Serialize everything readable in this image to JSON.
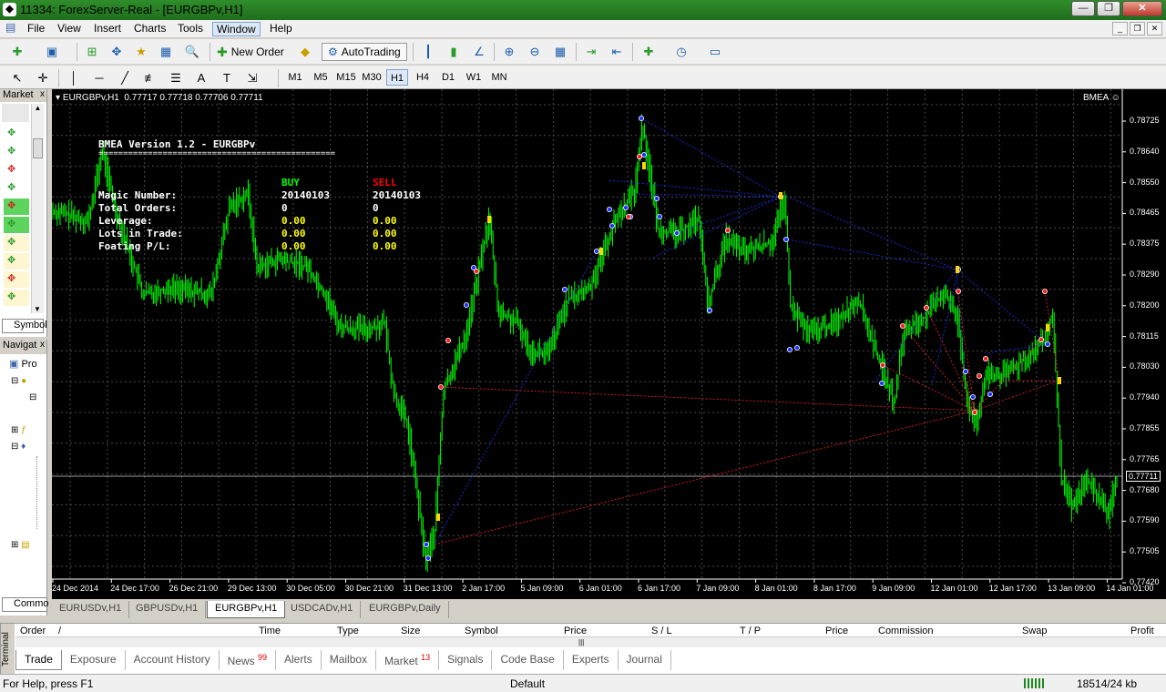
{
  "window": {
    "title": "11334: ForexServer-Real - [EURGBPv,H1]",
    "min": "—",
    "max": "❐",
    "close": "✕"
  },
  "menu": [
    "File",
    "View",
    "Insert",
    "Charts",
    "Tools",
    "Window",
    "Help"
  ],
  "toolbar": {
    "new_order": "New Order",
    "autotrading": "AutoTrading",
    "search_placeholder": "",
    "help": "?"
  },
  "timeframes": [
    "M1",
    "M5",
    "M15",
    "M30",
    "H1",
    "H4",
    "D1",
    "W1",
    "MN"
  ],
  "active_timeframe": "H1",
  "market_watch": {
    "title": "Market",
    "close": "x",
    "tab": "Symbol"
  },
  "navigator": {
    "title": "Navigat",
    "close": "x",
    "item": "Pro",
    "tab": "Commo"
  },
  "chart": {
    "header": "EURGBPv,H1  0.77717 0.77718 0.77706 0.77711",
    "ea_name": "BMEA ☺",
    "ea_title": "BMEA Version 1.2 - EURGBPv",
    "ea_sep": "================================================",
    "col_buy": "BUY",
    "col_sell": "SELL",
    "rows": [
      {
        "label": "Magic Number:",
        "buy": "20140103",
        "sell": "20140103"
      },
      {
        "label": "Total Orders:",
        "buy": "0",
        "sell": "0"
      },
      {
        "label": "Leverage:",
        "buy": "0.00",
        "sell": "0.00"
      },
      {
        "label": "Lots in Trade:",
        "buy": "0.00",
        "sell": "0.00"
      },
      {
        "label": "Foating P/L:",
        "buy": "0.00",
        "sell": "0.00"
      }
    ],
    "price_labels": [
      "0.78725",
      "0.78640",
      "0.78550",
      "0.78465",
      "0.78375",
      "0.78290",
      "0.78200",
      "0.78115",
      "0.78030",
      "0.77940",
      "0.77855",
      "0.77765",
      "0.77680",
      "0.77590",
      "0.77505",
      "0.77420"
    ],
    "current_price": "0.77711",
    "time_labels": [
      "24 Dec 2014",
      "24 Dec 17:00",
      "26 Dec 21:00",
      "29 Dec 13:00",
      "30 Dec 05:00",
      "30 Dec 21:00",
      "31 Dec 13:00",
      "2 Jan 17:00",
      "5 Jan 09:00",
      "6 Jan 01:00",
      "6 Jan 17:00",
      "7 Jan 09:00",
      "8 Jan 01:00",
      "8 Jan 17:00",
      "9 Jan 09:00",
      "12 Jan 01:00",
      "12 Jan 17:00",
      "13 Jan 09:00",
      "14 Jan 01:00"
    ],
    "colors": {
      "candle": "#00ff00",
      "grid": "#4a4a4a",
      "buy_text": "#00ff00",
      "sell_text": "#ff0000",
      "value_text": "#ffff00",
      "buy_lines": "#1a33ff",
      "sell_lines": "#ff2020"
    }
  },
  "chart_tabs": [
    "EURUSDv,H1",
    "GBPUSDv,H1",
    "EURGBPv,H1",
    "USDCADv,H1",
    "EURGBPv,Daily"
  ],
  "active_chart_tab": "EURGBPv,H1",
  "terminal": {
    "side_label": "Terminal",
    "columns": [
      "Order",
      "/",
      "Time",
      "Type",
      "Size",
      "Symbol",
      "Price",
      "S / L",
      "T / P",
      "Price",
      "Commission",
      "Swap",
      "Profit"
    ],
    "tabs": [
      {
        "label": "Trade",
        "badge": ""
      },
      {
        "label": "Exposure",
        "badge": ""
      },
      {
        "label": "Account History",
        "badge": ""
      },
      {
        "label": "News",
        "badge": "99"
      },
      {
        "label": "Alerts",
        "badge": ""
      },
      {
        "label": "Mailbox",
        "badge": ""
      },
      {
        "label": "Market",
        "badge": "13"
      },
      {
        "label": "Signals",
        "badge": ""
      },
      {
        "label": "Code Base",
        "badge": ""
      },
      {
        "label": "Experts",
        "badge": ""
      },
      {
        "label": "Journal",
        "badge": ""
      }
    ]
  },
  "status": {
    "help": "For Help, press F1",
    "profile": "Default",
    "traffic": "18514/24 kb"
  }
}
